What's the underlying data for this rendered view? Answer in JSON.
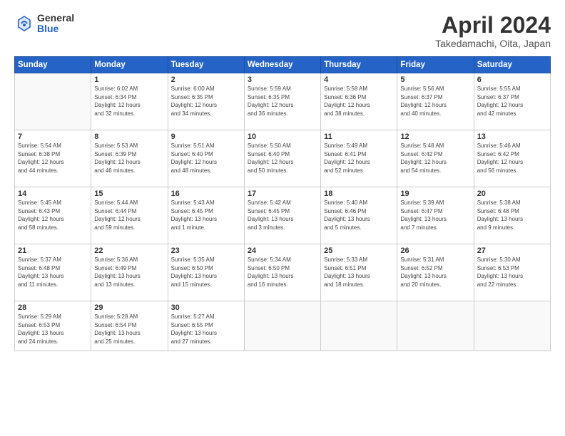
{
  "header": {
    "logo_general": "General",
    "logo_blue": "Blue",
    "title": "April 2024",
    "subtitle": "Takedamachi, Oita, Japan"
  },
  "weekdays": [
    "Sunday",
    "Monday",
    "Tuesday",
    "Wednesday",
    "Thursday",
    "Friday",
    "Saturday"
  ],
  "weeks": [
    [
      {
        "day": "",
        "info": ""
      },
      {
        "day": "1",
        "info": "Sunrise: 6:02 AM\nSunset: 6:34 PM\nDaylight: 12 hours\nand 32 minutes."
      },
      {
        "day": "2",
        "info": "Sunrise: 6:00 AM\nSunset: 6:35 PM\nDaylight: 12 hours\nand 34 minutes."
      },
      {
        "day": "3",
        "info": "Sunrise: 5:59 AM\nSunset: 6:35 PM\nDaylight: 12 hours\nand 36 minutes."
      },
      {
        "day": "4",
        "info": "Sunrise: 5:58 AM\nSunset: 6:36 PM\nDaylight: 12 hours\nand 38 minutes."
      },
      {
        "day": "5",
        "info": "Sunrise: 5:56 AM\nSunset: 6:37 PM\nDaylight: 12 hours\nand 40 minutes."
      },
      {
        "day": "6",
        "info": "Sunrise: 5:55 AM\nSunset: 6:37 PM\nDaylight: 12 hours\nand 42 minutes."
      }
    ],
    [
      {
        "day": "7",
        "info": "Sunrise: 5:54 AM\nSunset: 6:38 PM\nDaylight: 12 hours\nand 44 minutes."
      },
      {
        "day": "8",
        "info": "Sunrise: 5:53 AM\nSunset: 6:39 PM\nDaylight: 12 hours\nand 46 minutes."
      },
      {
        "day": "9",
        "info": "Sunrise: 5:51 AM\nSunset: 6:40 PM\nDaylight: 12 hours\nand 48 minutes."
      },
      {
        "day": "10",
        "info": "Sunrise: 5:50 AM\nSunset: 6:40 PM\nDaylight: 12 hours\nand 50 minutes."
      },
      {
        "day": "11",
        "info": "Sunrise: 5:49 AM\nSunset: 6:41 PM\nDaylight: 12 hours\nand 52 minutes."
      },
      {
        "day": "12",
        "info": "Sunrise: 5:48 AM\nSunset: 6:42 PM\nDaylight: 12 hours\nand 54 minutes."
      },
      {
        "day": "13",
        "info": "Sunrise: 5:46 AM\nSunset: 6:42 PM\nDaylight: 12 hours\nand 56 minutes."
      }
    ],
    [
      {
        "day": "14",
        "info": "Sunrise: 5:45 AM\nSunset: 6:43 PM\nDaylight: 12 hours\nand 58 minutes."
      },
      {
        "day": "15",
        "info": "Sunrise: 5:44 AM\nSunset: 6:44 PM\nDaylight: 12 hours\nand 59 minutes."
      },
      {
        "day": "16",
        "info": "Sunrise: 5:43 AM\nSunset: 6:45 PM\nDaylight: 13 hours\nand 1 minute."
      },
      {
        "day": "17",
        "info": "Sunrise: 5:42 AM\nSunset: 6:45 PM\nDaylight: 13 hours\nand 3 minutes."
      },
      {
        "day": "18",
        "info": "Sunrise: 5:40 AM\nSunset: 6:46 PM\nDaylight: 13 hours\nand 5 minutes."
      },
      {
        "day": "19",
        "info": "Sunrise: 5:39 AM\nSunset: 6:47 PM\nDaylight: 13 hours\nand 7 minutes."
      },
      {
        "day": "20",
        "info": "Sunrise: 5:38 AM\nSunset: 6:48 PM\nDaylight: 13 hours\nand 9 minutes."
      }
    ],
    [
      {
        "day": "21",
        "info": "Sunrise: 5:37 AM\nSunset: 6:48 PM\nDaylight: 13 hours\nand 11 minutes."
      },
      {
        "day": "22",
        "info": "Sunrise: 5:36 AM\nSunset: 6:49 PM\nDaylight: 13 hours\nand 13 minutes."
      },
      {
        "day": "23",
        "info": "Sunrise: 5:35 AM\nSunset: 6:50 PM\nDaylight: 13 hours\nand 15 minutes."
      },
      {
        "day": "24",
        "info": "Sunrise: 5:34 AM\nSunset: 6:50 PM\nDaylight: 13 hours\nand 16 minutes."
      },
      {
        "day": "25",
        "info": "Sunrise: 5:33 AM\nSunset: 6:51 PM\nDaylight: 13 hours\nand 18 minutes."
      },
      {
        "day": "26",
        "info": "Sunrise: 5:31 AM\nSunset: 6:52 PM\nDaylight: 13 hours\nand 20 minutes."
      },
      {
        "day": "27",
        "info": "Sunrise: 5:30 AM\nSunset: 6:53 PM\nDaylight: 13 hours\nand 22 minutes."
      }
    ],
    [
      {
        "day": "28",
        "info": "Sunrise: 5:29 AM\nSunset: 6:53 PM\nDaylight: 13 hours\nand 24 minutes."
      },
      {
        "day": "29",
        "info": "Sunrise: 5:28 AM\nSunset: 6:54 PM\nDaylight: 13 hours\nand 25 minutes."
      },
      {
        "day": "30",
        "info": "Sunrise: 5:27 AM\nSunset: 6:55 PM\nDaylight: 13 hours\nand 27 minutes."
      },
      {
        "day": "",
        "info": ""
      },
      {
        "day": "",
        "info": ""
      },
      {
        "day": "",
        "info": ""
      },
      {
        "day": "",
        "info": ""
      }
    ]
  ]
}
